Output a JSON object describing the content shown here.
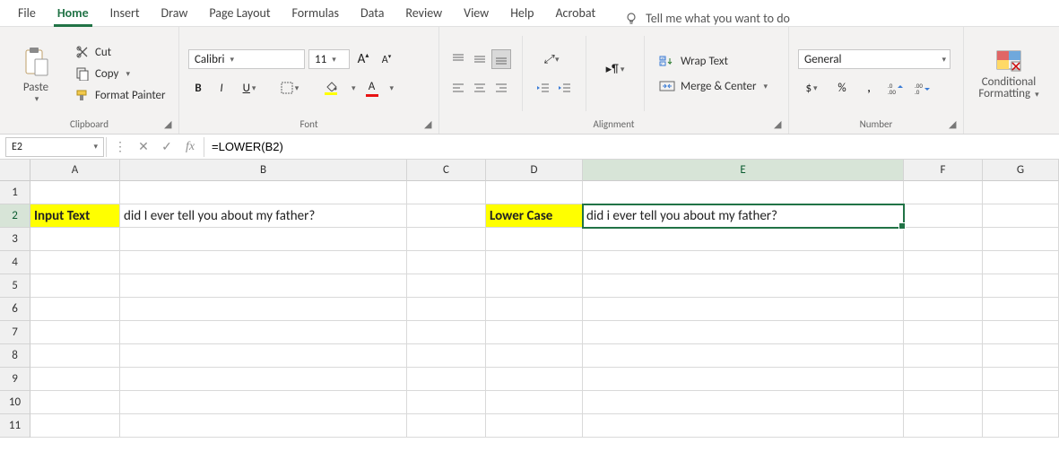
{
  "tabs": {
    "file": "File",
    "home": "Home",
    "insert": "Insert",
    "draw": "Draw",
    "pagelayout": "Page Layout",
    "formulas": "Formulas",
    "data": "Data",
    "review": "Review",
    "view": "View",
    "help": "Help",
    "acrobat": "Acrobat",
    "tellme": "Tell me what you want to do"
  },
  "clipboard": {
    "paste": "Paste",
    "cut": "Cut",
    "copy": "Copy",
    "formatpainter": "Format Painter",
    "group": "Clipboard"
  },
  "font": {
    "name": "Calibri",
    "size": "11",
    "bold": "B",
    "italic": "I",
    "underline": "U",
    "group": "Font"
  },
  "alignment": {
    "wrap": "Wrap Text",
    "merge": "Merge & Center",
    "group": "Alignment"
  },
  "number": {
    "format": "General",
    "group": "Number",
    "percent": "%",
    "comma": ",",
    "currency": "$"
  },
  "cond": {
    "label1": "Conditional",
    "label2": "Formatting"
  },
  "fbar": {
    "name": "E2",
    "formula": "=LOWER(B2)"
  },
  "sheet": {
    "columns": [
      "A",
      "B",
      "C",
      "D",
      "E",
      "F",
      "G"
    ],
    "rows": [
      "1",
      "2",
      "3",
      "4",
      "5",
      "6",
      "7",
      "8",
      "9",
      "10",
      "11"
    ],
    "activeCol": "E",
    "activeRow": "2",
    "r2": {
      "A": "Input Text",
      "B": "did I ever tell you about my father?",
      "D": "Lower Case",
      "E": "did i ever tell you about my father?"
    }
  }
}
